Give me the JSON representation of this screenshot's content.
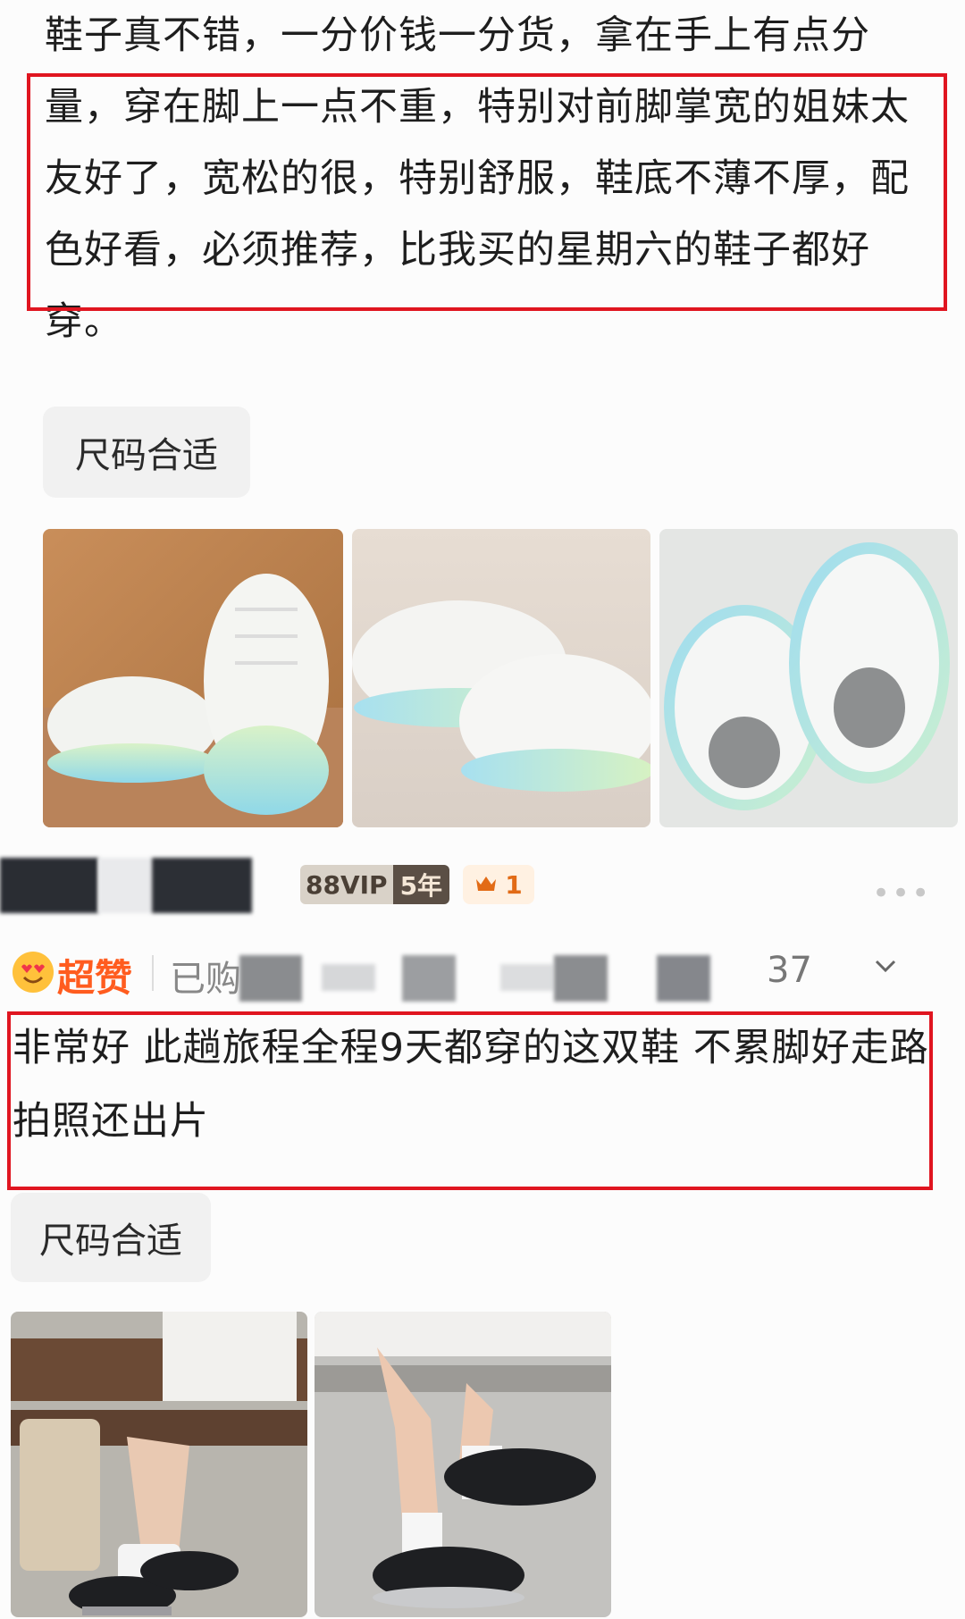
{
  "review1": {
    "text": "鞋子真不错，一分价钱一分货，拿在手上有点分量，穿在脚上一点不重，特别对前脚掌宽的姐妹太友好了，宽松的很，特别舒服，鞋底不薄不厚，配色好看，必须推荐，比我买的星期六的鞋子都好穿。",
    "tag": "尺码合适"
  },
  "reviewer": {
    "vip_label": "88VIP",
    "vip_years": "5年",
    "crown_count": "1",
    "more": "•••"
  },
  "rating": {
    "label": "超赞",
    "purchased_prefix": "已购",
    "likes": "37",
    "expand_icon": "chevron-down-icon"
  },
  "review2": {
    "text": "非常好 此趟旅程全程9天都穿的这双鞋 不累脚好走路 拍照还出片",
    "tag": "尺码合适"
  },
  "colors": {
    "highlight_border": "#e01520",
    "rating_orange": "#ff5c1f",
    "tag_bg": "#f1f1f1"
  }
}
